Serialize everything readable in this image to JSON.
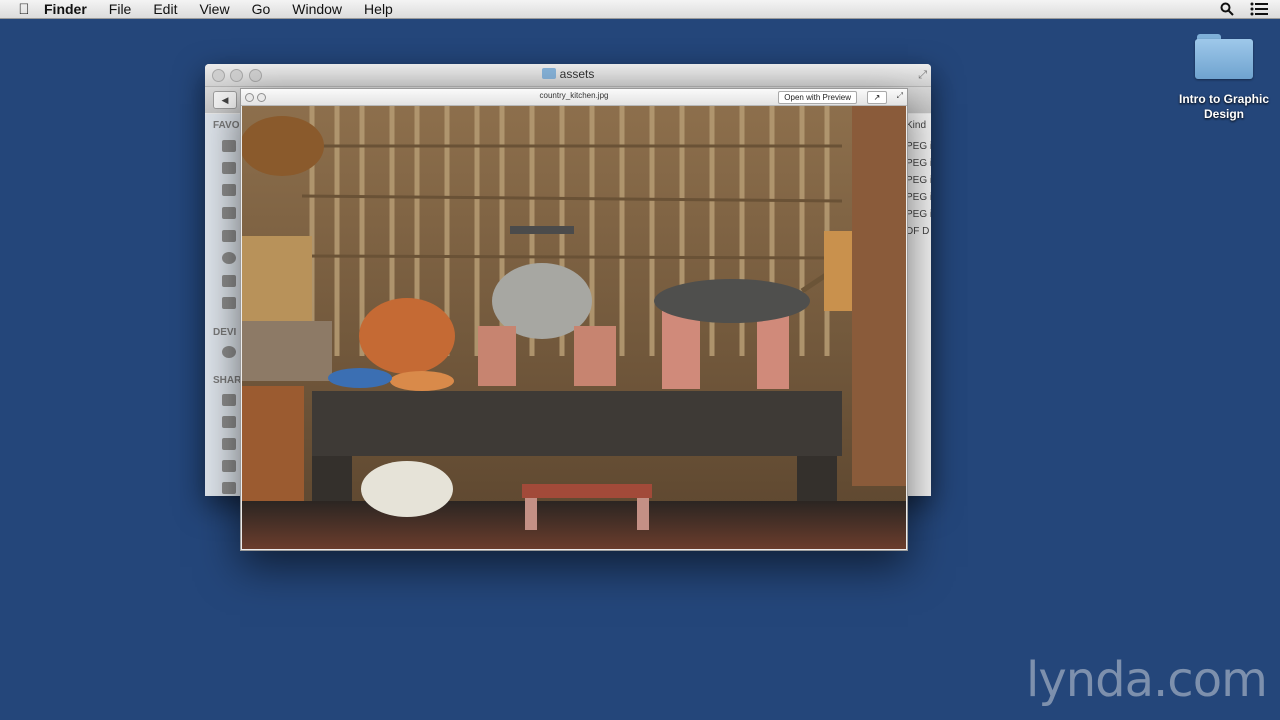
{
  "menubar": {
    "items": [
      "Finder",
      "File",
      "Edit",
      "View",
      "Go",
      "Window",
      "Help"
    ]
  },
  "desktop": {
    "icon_label": "Intro to Graphic Design"
  },
  "finder": {
    "title": "assets",
    "sidebar_headers": [
      "FAVO",
      "DEVI",
      "SHAR"
    ],
    "kind_header": "Kind",
    "kind_values": [
      "PEG i",
      "PEG i",
      "PEG i",
      "PEG i",
      "PEG i",
      "DF D"
    ]
  },
  "quicklook": {
    "filename": "country_kitchen.jpg",
    "open_button": "Open with Preview"
  },
  "watermark": "lynda.com",
  "colors": {
    "desktop": "#24467a",
    "folder": "#86b2d8"
  }
}
